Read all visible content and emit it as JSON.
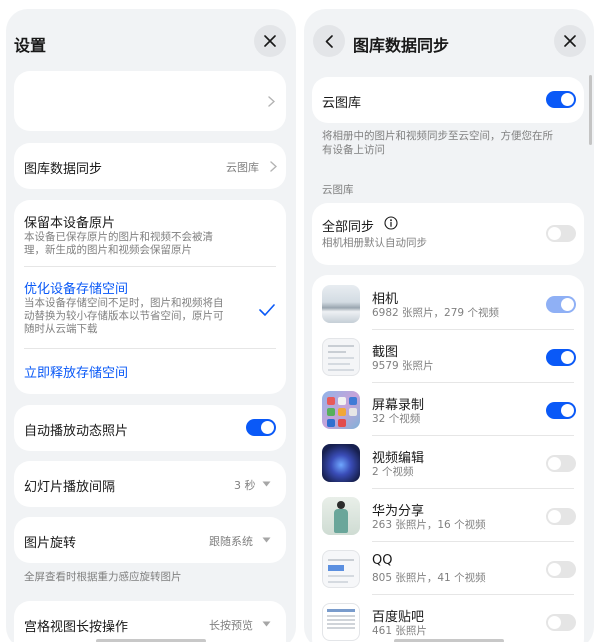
{
  "left": {
    "title": "设置",
    "sync_row": {
      "label": "图库数据同步",
      "value": "云图库"
    },
    "storage": {
      "keep_title": "保留本设备原片",
      "keep_desc_1": "本设备已保存原片的图片和视频不会被清",
      "keep_desc_2": "理，新生成的图片和视频会保留原片",
      "optimize_title": "优化设备存储空间",
      "optimize_desc_1": "当本设备存储空间不足时，图片和视频将自",
      "optimize_desc_2": "动替换为较小存储版本以节省空间，原片可",
      "optimize_desc_3": "随时从云端下载",
      "free_label": "立即释放存储空间"
    },
    "autoplay_label": "自动播放动态照片",
    "slideshow": {
      "label": "幻灯片播放间隔",
      "value": "3 秒"
    },
    "rotation": {
      "label": "图片旋转",
      "value": "跟随系统",
      "caption": "全屏查看时根据重力感应旋转图片"
    },
    "grid_longpress": {
      "label": "宫格视图长按操作",
      "value": "长按预览"
    }
  },
  "right": {
    "title": "图库数据同步",
    "cloud_label": "云图库",
    "cloud_desc_1": "将相册中的图片和视频同步至云空间，方便您在所",
    "cloud_desc_2": "有设备上访问",
    "section_label": "云图库",
    "all_sync": {
      "label": "全部同步",
      "desc": "相机相册默认自动同步"
    },
    "albums": [
      {
        "name": "相机",
        "count": "6982 张照片，279 个视频",
        "state": "light"
      },
      {
        "name": "截图",
        "count": "9579 张照片",
        "state": "on"
      },
      {
        "name": "屏幕录制",
        "count": "32 个视频",
        "state": "on"
      },
      {
        "name": "视频编辑",
        "count": "2 个视频",
        "state": "off"
      },
      {
        "name": "华为分享",
        "count": "263 张照片，16 个视频",
        "state": "off"
      },
      {
        "name": "QQ",
        "count": "805 张照片，41 个视频",
        "state": "off"
      },
      {
        "name": "百度贴吧",
        "count": "461 张照片",
        "state": "off"
      }
    ]
  },
  "colors": {
    "accent": "#0a59f7",
    "background": "#f1f3f5",
    "card": "#ffffff",
    "muted_text": "#808080"
  },
  "icons": [
    "close-icon",
    "back-arrow-icon",
    "chevron-right-icon",
    "chevron-down-icon",
    "check-icon",
    "info-icon"
  ]
}
